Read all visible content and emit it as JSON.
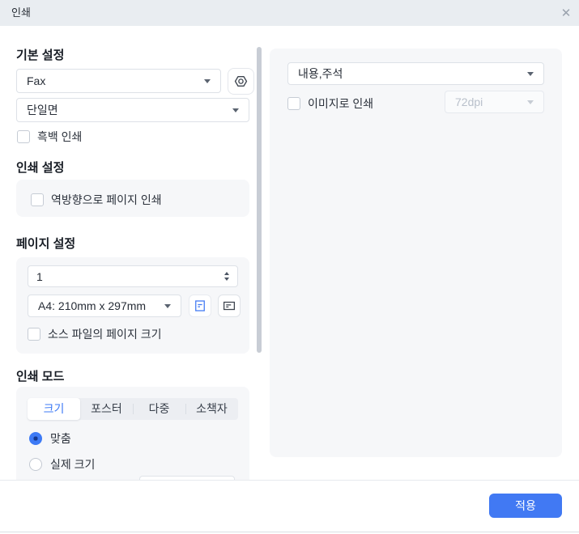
{
  "window": {
    "title": "인쇄",
    "close_glyph": "✕"
  },
  "left_panel": {
    "basic": {
      "heading": "기본 설정",
      "printer_select": {
        "value": "Fax"
      },
      "sides_select": {
        "value": "단일면"
      },
      "grayscale_checkbox": {
        "label": "흑백 인쇄",
        "checked": false
      }
    },
    "print_settings": {
      "heading": "인쇄 설정",
      "reverse_checkbox": {
        "label": "역방향으로 페이지 인쇄",
        "checked": false
      }
    },
    "page_settings": {
      "heading": "페이지 설정",
      "page_range_input": {
        "value": "1"
      },
      "paper_size_select": {
        "value": "A4: 210mm x 297mm"
      },
      "source_size_checkbox": {
        "label": "소스 파일의 페이지 크기",
        "checked": false
      }
    },
    "print_mode": {
      "heading": "인쇄 모드",
      "tabs": [
        {
          "label": "크기",
          "active": true
        },
        {
          "label": "포스터",
          "active": false
        },
        {
          "label": "다중",
          "active": false
        },
        {
          "label": "소책자",
          "active": false
        }
      ],
      "options": [
        {
          "label": "맞춤",
          "selected": true
        },
        {
          "label": "실제 크기",
          "selected": false
        }
      ]
    }
  },
  "right_panel": {
    "content_select": {
      "value": "내용,주석"
    },
    "print_as_image_checkbox": {
      "label": "이미지로 인쇄",
      "checked": false
    },
    "dpi_select": {
      "value": "72dpi",
      "disabled": true
    }
  },
  "footer": {
    "apply_button": "적용"
  },
  "colors": {
    "accent_blue": "#4179f3",
    "titlebar_bg": "#e9edf1",
    "panel_bg": "#f6f7f9",
    "disabled_text": "#b9c0cb"
  }
}
